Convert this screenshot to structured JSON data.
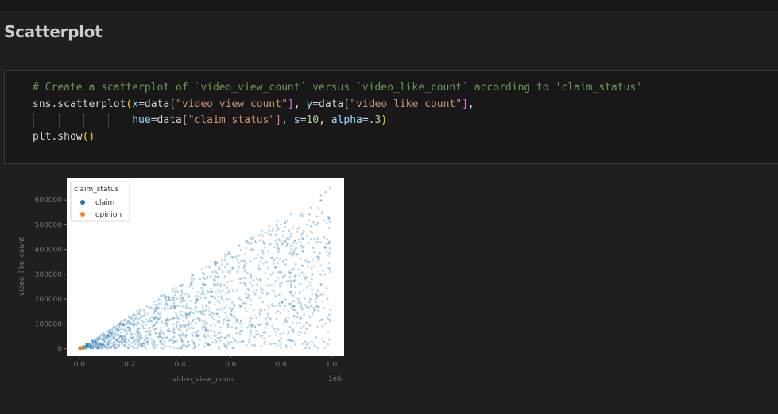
{
  "heading": "Scatterplot",
  "code": {
    "comment": "# Create a scatterplot of `video_view_count` versus `video_like_count` according to 'claim_status'",
    "l2_fn": "sns.scatterplot",
    "l2_x": "x",
    "l2_eq1": "=data",
    "l2_xs": "\"video_view_count\"",
    "l2_comma": ", ",
    "l2_y": "y",
    "l2_eq2": "=data",
    "l2_ys": "\"video_like_count\"",
    "l2_end": ",",
    "l3_hue": "hue",
    "l3_eq": "=data",
    "l3_hs": "\"claim_status\"",
    "l3_c1": ", ",
    "l3_s": "s",
    "l3_eq2": "=",
    "l3_sv": "10",
    "l3_c2": ", ",
    "l3_a": "alpha",
    "l3_eq3": "=",
    "l3_av": ".3",
    "l4": "plt.show",
    "open_paren": "(",
    "close_paren": ")",
    "open_bracket": "[",
    "close_bracket": "]"
  },
  "chart_data": {
    "type": "scatter",
    "xlabel": "video_view_count",
    "ylabel": "video_like_count",
    "x_offset_label": "1e6",
    "xlim": [
      -0.05,
      1.05
    ],
    "ylim": [
      -30000,
      690000
    ],
    "xticks": [
      0.0,
      0.2,
      0.4,
      0.6,
      0.8,
      1.0
    ],
    "xtick_labels": [
      "0.0",
      "0.2",
      "0.4",
      "0.6",
      "0.8",
      "1.0"
    ],
    "yticks": [
      0,
      100000,
      200000,
      300000,
      400000,
      500000,
      600000
    ],
    "ytick_labels": [
      "0",
      "100000",
      "200000",
      "300000",
      "400000",
      "500000",
      "600000"
    ],
    "legend": {
      "title": "claim_status",
      "position": "top-left"
    },
    "grid": false,
    "series": [
      {
        "name": "claim",
        "color": "#1f77b4",
        "x_range": [
          0.0,
          1.0
        ],
        "max_like_to_view_ratio": 0.66,
        "y_max": 660000,
        "point_count": 1500
      },
      {
        "name": "opinion",
        "color": "#ff7f0e",
        "x_range": [
          0.0,
          0.01
        ],
        "y_range": [
          0,
          6000
        ],
        "point_count": 40
      }
    ]
  }
}
